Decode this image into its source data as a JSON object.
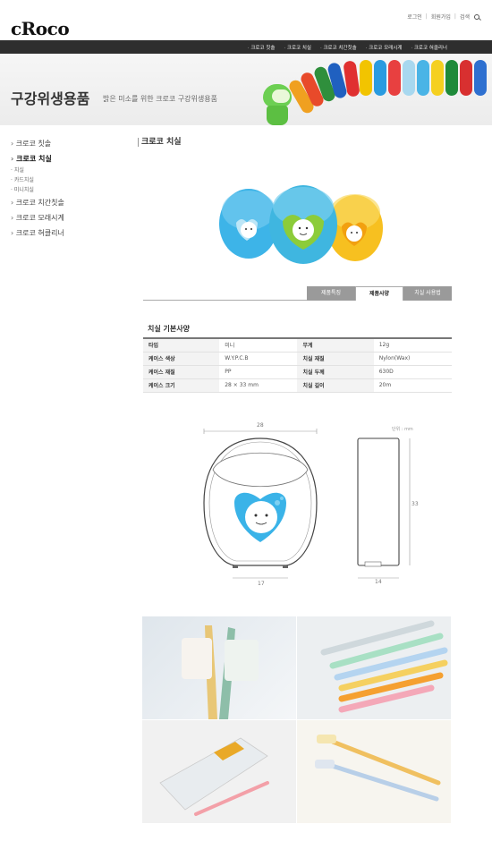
{
  "header": {
    "logo": "cRoco",
    "util": {
      "login": "로그인",
      "join": "회원가입",
      "search": "검색"
    },
    "gnb": [
      "크로코 칫솔",
      "크로코 치실",
      "크로코 치간칫솔",
      "크로코 모래시계",
      "크로코 혀클리너"
    ]
  },
  "banner": {
    "title": "구강위생용품",
    "subtitle": "밝은 미소를 위한 크로코 구강위생용품"
  },
  "sidebar": {
    "items": [
      "크로코 칫솔",
      "크로코 치실",
      "크로코 치간칫솔",
      "크로코 모래시계",
      "크로코 혀클리너"
    ],
    "sub_items": [
      "치실",
      "카드치실",
      "미니치실"
    ]
  },
  "content": {
    "title": "크로코 치실",
    "tabs": [
      "제품특징",
      "제품사양",
      "치실 사용법"
    ],
    "active_tab": "제품사양",
    "spec_title": "치실 기본사양",
    "spec_rows": [
      [
        "타입",
        "미니",
        "무게",
        "12g"
      ],
      [
        "케이스 색상",
        "W.Y.P.C.B",
        "치실 재질",
        "Nylon(Wax)"
      ],
      [
        "케이스 재질",
        "PP",
        "치실 두께",
        "630D"
      ],
      [
        "케이스 크기",
        "28 × 33 mm",
        "치실 길이",
        "20m"
      ]
    ]
  },
  "drawing": {
    "width_top": "28",
    "height_side": "33",
    "width_bottom": "17",
    "depth_bottom": "14",
    "unit": "단위 : mm"
  },
  "colors": {
    "nav_bg": "#2e2e2e",
    "case_blue": "#3db4e8",
    "case_green": "#8ccc3a",
    "case_yellow": "#f7b820"
  }
}
